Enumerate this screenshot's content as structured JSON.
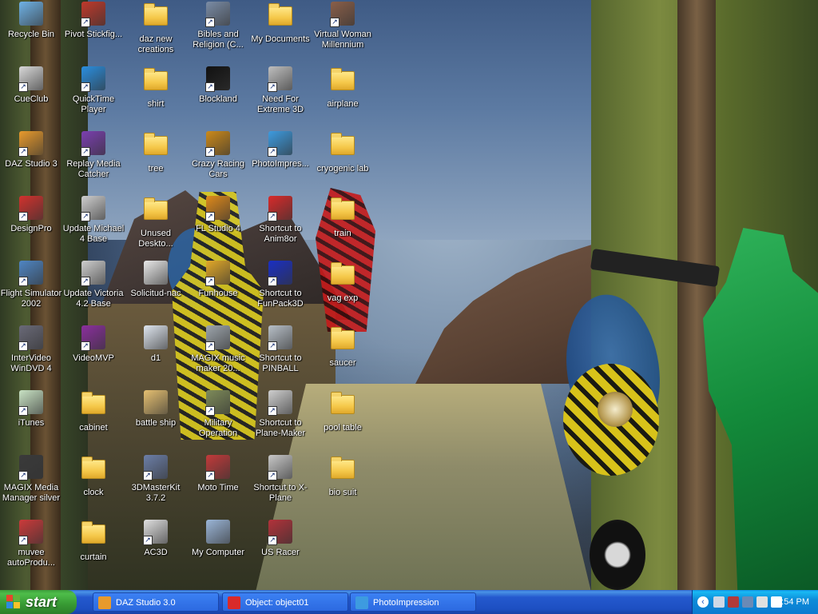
{
  "desktop": {
    "icons": [
      {
        "label": "Recycle Bin",
        "icon": "recycle-bin-icon",
        "kind": "app",
        "color": "#6fb2e6",
        "shortcut": false
      },
      {
        "label": "Pivot Stickfig...",
        "icon": "stickfigure-icon",
        "kind": "app",
        "color": "#c0392b",
        "shortcut": true
      },
      {
        "label": "daz new creations",
        "icon": "folder-icon",
        "kind": "folder",
        "color": "#f5c84a",
        "shortcut": false
      },
      {
        "label": "Bibles and Religion (C...",
        "icon": "bible-app-icon",
        "kind": "app",
        "color": "#7a8ca6",
        "shortcut": true
      },
      {
        "label": "My Documents",
        "icon": "my-documents-icon",
        "kind": "folder",
        "color": "#f5c84a",
        "shortcut": false
      },
      {
        "label": "Virtual Woman Millennium",
        "icon": "virtual-woman-icon",
        "kind": "app",
        "color": "#8a5f49",
        "shortcut": true
      },
      {
        "label": "CueClub",
        "icon": "cueclub-icon",
        "kind": "app",
        "color": "#d9d9d9",
        "shortcut": true
      },
      {
        "label": "QuickTime Player",
        "icon": "quicktime-icon",
        "kind": "app",
        "color": "#2a8fe0",
        "shortcut": true
      },
      {
        "label": "shirt",
        "icon": "folder-icon",
        "kind": "folder",
        "color": "#f5c84a",
        "shortcut": false
      },
      {
        "label": "Blockland",
        "icon": "blockland-icon",
        "kind": "app",
        "color": "#111111",
        "shortcut": true
      },
      {
        "label": "Need For Extreme 3D",
        "icon": "wheel-icon",
        "kind": "app",
        "color": "#bfbfbf",
        "shortcut": true
      },
      {
        "label": "airplane",
        "icon": "folder-icon",
        "kind": "folder",
        "color": "#f5c84a",
        "shortcut": false
      },
      {
        "label": "DAZ Studio 3",
        "icon": "daz-studio-icon",
        "kind": "app",
        "color": "#e89a2c",
        "shortcut": true
      },
      {
        "label": "Replay Media Catcher",
        "icon": "replay-media-icon",
        "kind": "app",
        "color": "#7b3fb0",
        "shortcut": true
      },
      {
        "label": "tree",
        "icon": "folder-icon",
        "kind": "folder",
        "color": "#f5c84a",
        "shortcut": false
      },
      {
        "label": "Crazy Racing Cars",
        "icon": "racing-cars-icon",
        "kind": "app",
        "color": "#cc8a1a",
        "shortcut": true
      },
      {
        "label": "PhotoImpres...",
        "icon": "photoimpression-icon",
        "kind": "app",
        "color": "#3d9be0",
        "shortcut": true
      },
      {
        "label": "cryogenic lab",
        "icon": "folder-icon",
        "kind": "folder",
        "color": "#f5c84a",
        "shortcut": false
      },
      {
        "label": "DesignPro",
        "icon": "designpro-icon",
        "kind": "app",
        "color": "#d2322d",
        "shortcut": true
      },
      {
        "label": "Update Michael 4 Base",
        "icon": "update-michael-icon",
        "kind": "app",
        "color": "#cfcfcf",
        "shortcut": true
      },
      {
        "label": "Unused Deskto...",
        "icon": "folder-icon",
        "kind": "folder",
        "color": "#f5c84a",
        "shortcut": false
      },
      {
        "label": "FL Studio 4",
        "icon": "fl-studio-icon",
        "kind": "app",
        "color": "#e08a1a",
        "shortcut": true
      },
      {
        "label": "Shortcut to Anim8or",
        "icon": "anim8or-icon",
        "kind": "app",
        "color": "#d92a2a",
        "shortcut": true
      },
      {
        "label": "train",
        "icon": "folder-icon",
        "kind": "folder",
        "color": "#f5c84a",
        "shortcut": false
      },
      {
        "label": "Flight Simulator 2002",
        "icon": "flight-simulator-icon",
        "kind": "app",
        "color": "#4f86c4",
        "shortcut": true
      },
      {
        "label": "Update Victoria 4.2 Base",
        "icon": "update-victoria-icon",
        "kind": "app",
        "color": "#cfcfcf",
        "shortcut": true
      },
      {
        "label": "Solicitud-nac",
        "icon": "pdf-file-icon",
        "kind": "app",
        "color": "#e9e9e9",
        "shortcut": false
      },
      {
        "label": "Funhouse",
        "icon": "funhouse-icon",
        "kind": "app",
        "color": "#e3a928",
        "shortcut": true
      },
      {
        "label": "Shortcut to FunPack3D",
        "icon": "funpack3d-icon",
        "kind": "app",
        "color": "#1a2fc4",
        "shortcut": true
      },
      {
        "label": "vag exp",
        "icon": "folder-icon",
        "kind": "folder",
        "color": "#f5c84a",
        "shortcut": false
      },
      {
        "label": "InterVideo WinDVD 4",
        "icon": "windvd-icon",
        "kind": "app",
        "color": "#6a6a78",
        "shortcut": true
      },
      {
        "label": "VideoMVP",
        "icon": "videomvp-icon",
        "kind": "app",
        "color": "#8b2f9e",
        "shortcut": true
      },
      {
        "label": "d1",
        "icon": "text-file-icon",
        "kind": "app",
        "color": "#dfe6ef",
        "shortcut": false
      },
      {
        "label": "MAGIX music maker 20...",
        "icon": "magix-music-icon",
        "kind": "app",
        "color": "#9ea6ad",
        "shortcut": true
      },
      {
        "label": "Shortcut to PINBALL",
        "icon": "pinball-icon",
        "kind": "app",
        "color": "#b8c0c8",
        "shortcut": true
      },
      {
        "label": "saucer",
        "icon": "folder-icon",
        "kind": "folder",
        "color": "#f5c84a",
        "shortcut": false
      },
      {
        "label": "iTunes",
        "icon": "itunes-icon",
        "kind": "app",
        "color": "#c9e3c4",
        "shortcut": true
      },
      {
        "label": "cabinet",
        "icon": "folder-icon",
        "kind": "folder",
        "color": "#f5c84a",
        "shortcut": false
      },
      {
        "label": "battle ship",
        "icon": "battleship-file-icon",
        "kind": "app",
        "color": "#e6c071",
        "shortcut": false
      },
      {
        "label": "Military Operation",
        "icon": "military-operation-icon",
        "kind": "app",
        "color": "#7f8c5a",
        "shortcut": true
      },
      {
        "label": "Shortcut to Plane-Maker",
        "icon": "plane-maker-icon",
        "kind": "app",
        "color": "#cfcfcf",
        "shortcut": true
      },
      {
        "label": "pool table",
        "icon": "folder-icon",
        "kind": "folder",
        "color": "#f5c84a",
        "shortcut": false
      },
      {
        "label": "MAGIX Media Manager silver",
        "icon": "magix-media-icon",
        "kind": "app",
        "color": "#3a3a3a",
        "shortcut": true
      },
      {
        "label": "clock",
        "icon": "folder-icon",
        "kind": "folder",
        "color": "#f5c84a",
        "shortcut": false
      },
      {
        "label": "3DMasterKit 3.7.2",
        "icon": "masterkit-icon",
        "kind": "app",
        "color": "#6c7fa8",
        "shortcut": true
      },
      {
        "label": "Moto Time",
        "icon": "moto-time-icon",
        "kind": "app",
        "color": "#c23a3a",
        "shortcut": true
      },
      {
        "label": "Shortcut to X-Plane",
        "icon": "x-plane-icon",
        "kind": "app",
        "color": "#c8c8c8",
        "shortcut": true
      },
      {
        "label": "bio suit",
        "icon": "folder-icon",
        "kind": "folder",
        "color": "#f5c84a",
        "shortcut": false
      },
      {
        "label": "muvee autoProdu...",
        "icon": "muvee-icon",
        "kind": "app",
        "color": "#cc3a3a",
        "shortcut": true
      },
      {
        "label": "curtain",
        "icon": "folder-icon",
        "kind": "folder",
        "color": "#f5c84a",
        "shortcut": false
      },
      {
        "label": "AC3D",
        "icon": "ac3d-icon",
        "kind": "app",
        "color": "#e0e0e0",
        "shortcut": true
      },
      {
        "label": "My Computer",
        "icon": "my-computer-icon",
        "kind": "app",
        "color": "#9bb6d8",
        "shortcut": false
      },
      {
        "label": "US Racer",
        "icon": "us-racer-icon",
        "kind": "app",
        "color": "#b3323a",
        "shortcut": true
      }
    ]
  },
  "taskbar": {
    "start_label": "start",
    "tasks": [
      {
        "label": "DAZ Studio 3.0",
        "icon": "daz-studio-icon",
        "color": "#e89a2c"
      },
      {
        "label": "Object: object01",
        "icon": "anim8or-icon",
        "color": "#d92a2a"
      },
      {
        "label": "PhotoImpression",
        "icon": "photoimpression-icon",
        "color": "#3d9be0"
      }
    ],
    "tray": {
      "expand_label": "‹",
      "icons": [
        {
          "name": "network-icon",
          "color": "#cfd8e6"
        },
        {
          "name": "security-icon",
          "color": "#b23a3a"
        },
        {
          "name": "display-icon",
          "color": "#6a8ab6"
        },
        {
          "name": "volume-icon",
          "color": "#e0e0e0"
        },
        {
          "name": "search-icon",
          "color": "#ffffff"
        }
      ],
      "clock": "4:54 PM"
    }
  }
}
